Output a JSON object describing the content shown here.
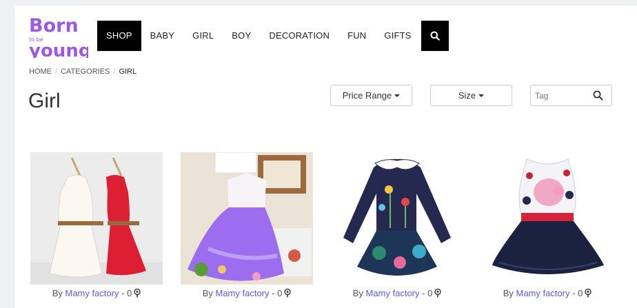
{
  "logo": {
    "line1": "Born",
    "line2": "to be",
    "line3": "young",
    "color": "#9b59e6"
  },
  "nav": {
    "items": [
      {
        "label": "SHOP",
        "active": true
      },
      {
        "label": "BABY"
      },
      {
        "label": "GIRL"
      },
      {
        "label": "BOY"
      },
      {
        "label": "DECORATION"
      },
      {
        "label": "FUN"
      },
      {
        "label": "GIFTS"
      }
    ],
    "search_icon": "search-icon"
  },
  "breadcrumb": {
    "home": "HOME",
    "categories": "CATEGORIES",
    "current": "GIRL",
    "separator": "/"
  },
  "page_title": "Girl",
  "filters": {
    "price_label": "Price Range",
    "size_label": "Size",
    "tag_placeholder": "Tag"
  },
  "products": [
    {
      "by": "By",
      "seller": "Mamy factory",
      "count_text": "- 0",
      "icon": "lollipop-icon"
    },
    {
      "by": "By",
      "seller": "Mamy factory",
      "count_text": "- 0",
      "icon": "lollipop-icon"
    },
    {
      "by": "By",
      "seller": "Mamy factory",
      "count_text": "- 0",
      "icon": "lollipop-icon"
    },
    {
      "by": "By",
      "seller": "Mamy factory",
      "count_text": "- 0",
      "icon": "lollipop-icon"
    }
  ],
  "colors": {
    "accent": "#9b59e6",
    "link": "#5b5bd6",
    "nav_active_bg": "#000000"
  }
}
